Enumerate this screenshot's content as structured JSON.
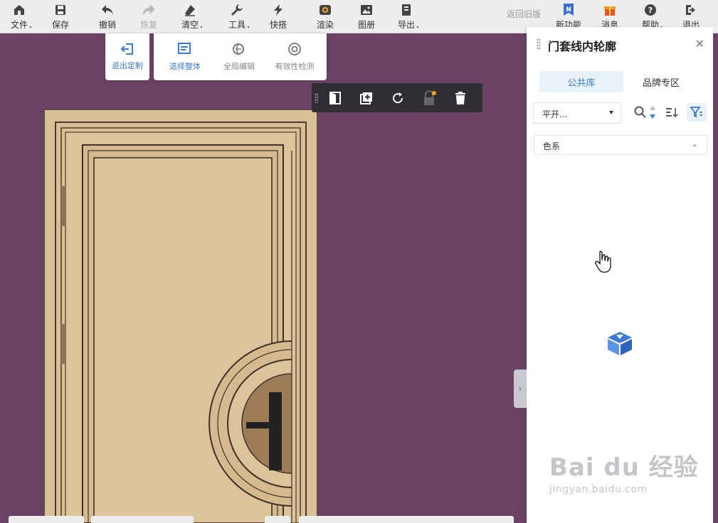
{
  "toolbar": {
    "file": "文件",
    "save": "保存",
    "undo": "撤销",
    "redo": "恢复",
    "clear": "清空",
    "tools": "工具",
    "quick": "快搭",
    "render": "渲染",
    "album": "图册",
    "export": "导出",
    "legacy": "返回旧版",
    "new_features": "新功能",
    "messages": "消息",
    "help": "帮助",
    "logout": "退出"
  },
  "custom_mode": {
    "exit": "退出定制",
    "select_whole": "选择整体",
    "global_edit": "全局编辑",
    "validity_check": "有效性检测"
  },
  "panel": {
    "title": "门套线内轮廓",
    "tabs": [
      "公共库",
      "品牌专区"
    ],
    "sort_value": "平开...",
    "color_filter": "色系"
  },
  "watermark": {
    "main": "Bai du 经验",
    "sub": "jingyan.baidu.com"
  },
  "colors": {
    "accent": "#3d7ad6",
    "canvas": "#6a4264",
    "door": "#dcc39a"
  }
}
